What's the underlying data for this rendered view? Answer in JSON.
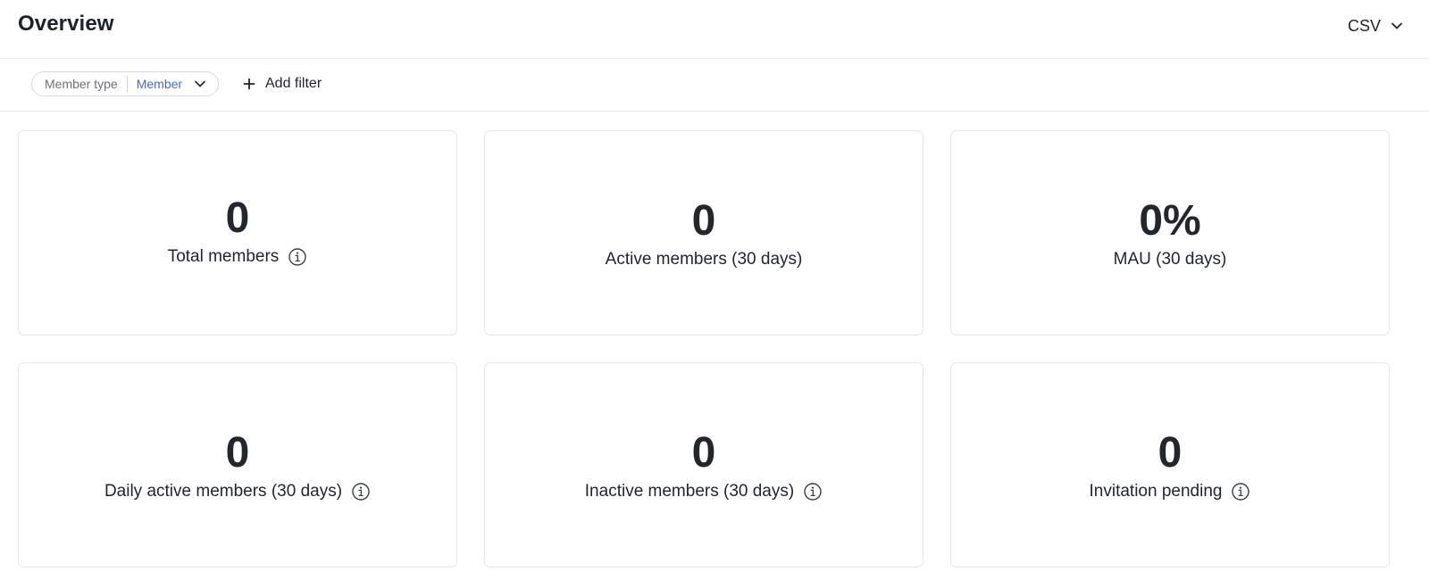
{
  "header": {
    "title": "Overview",
    "export_label": "CSV",
    "export_icon": "chevron-down-icon"
  },
  "filters": {
    "chip_key": "Member type",
    "chip_value": "Member",
    "add_filter_label": "Add filter",
    "add_filter_icon": "plus-icon"
  },
  "cards": [
    {
      "value": "0",
      "label": "Total members",
      "has_info": true
    },
    {
      "value": "0",
      "label": "Active members (30 days)",
      "has_info": false
    },
    {
      "value": "0%",
      "label": "MAU (30 days)",
      "has_info": false
    },
    {
      "value": "0",
      "label": "Daily active members (30 days)",
      "has_info": true
    },
    {
      "value": "0",
      "label": "Inactive members (30 days)",
      "has_info": true
    },
    {
      "value": "0",
      "label": "Invitation pending",
      "has_info": true
    }
  ],
  "colors": {
    "accent": "#4a64d8",
    "border": "#e3e5e8",
    "text": "#1f2430"
  }
}
